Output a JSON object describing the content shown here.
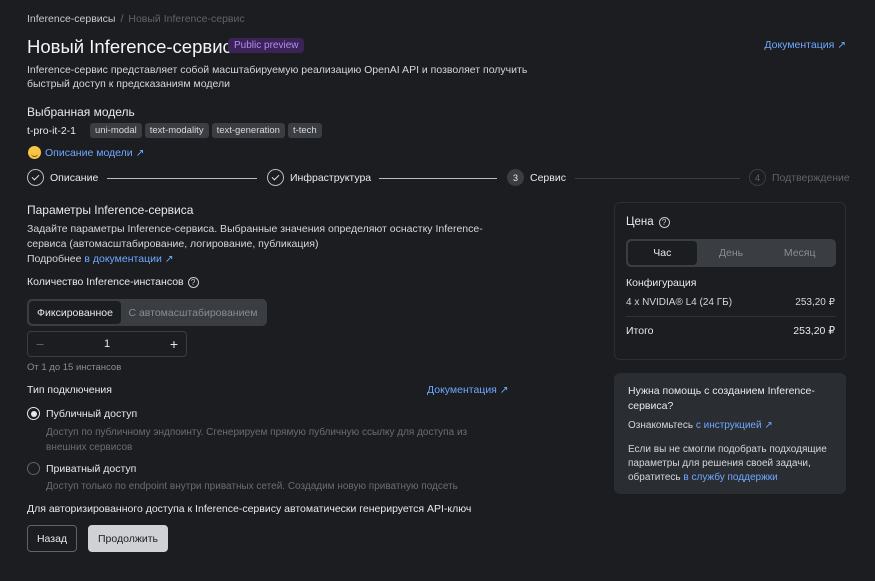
{
  "breadcrumb": {
    "parent": "Inference-сервисы",
    "separator": "/",
    "current": "Новый Inference-сервис"
  },
  "header": {
    "title": "Новый Inference-сервис",
    "badge": "Public preview",
    "doc_link": "Документация ↗",
    "description": "Inference-сервис представляет собой масштабируемую реализацию OpenAI API и позволяет получить быстрый доступ к предсказаниям модели"
  },
  "model": {
    "heading": "Выбранная модель",
    "name": "t-pro-it-2-1",
    "tags": [
      "uni-modal",
      "text-modality",
      "text-generation",
      "t-tech"
    ],
    "description_link": "Описание модели ↗"
  },
  "stepper": {
    "steps": [
      {
        "label": "Описание",
        "number": ""
      },
      {
        "label": "Инфраструктура",
        "number": ""
      },
      {
        "label": "Сервис",
        "number": "3"
      },
      {
        "label": "Подтверждение",
        "number": "4"
      }
    ]
  },
  "params": {
    "heading": "Параметры Inference-сервиса",
    "description": "Задайте параметры Inference-сервиса. Выбранные значения определяют оснастку Inference-сервиса (автомасштабирование, логирование, публикация)",
    "more_prefix": "Подробнее ",
    "more_link": "в документации ↗"
  },
  "instances": {
    "heading": "Количество Inference-инстансов",
    "help_icon": "?",
    "modes": [
      "Фиксированное",
      "С автомасштабированием"
    ],
    "selected_mode": "Фиксированное",
    "minus": "−",
    "value": "1",
    "plus": "+",
    "range_hint": "От 1 до 15 инстансов"
  },
  "connection": {
    "heading": "Тип подключения",
    "doc_link": "Документация ↗",
    "public_label": "Публичный доступ",
    "public_help": "Доступ по публичному эндпоинту. Сгенерируем прямую публичную ссылку для доступа из внешних сервисов",
    "private_label": "Приватный доступ",
    "private_help": "Доступ только по endpoint внутри приватных сетей. Создадим новую приватную подсеть",
    "selected": "public"
  },
  "api_note": "Для авторизированного доступа к Inference-сервису автоматически генерируется API-ключ",
  "actions": {
    "back": "Назад",
    "next": "Продолжить"
  },
  "price": {
    "title": "Цена",
    "help_icon": "?",
    "periods": [
      "Час",
      "День",
      "Месяц"
    ],
    "selected_period": "Час",
    "config_label": "Конфигурация",
    "config_item": "4 x NVIDIA® L4 (24 ГБ)",
    "config_price": "253,20 ₽",
    "total_label": "Итого",
    "total_price": "253,20 ₽"
  },
  "help_card": {
    "title": "Нужна помощь с созданием Inference-сервиса?",
    "text1_prefix": "Ознакомьтесь ",
    "text1_link": "с инструкцией ↗",
    "text2_prefix": "Если вы не смогли подобрать подходящие параметры для решения своей задачи, обратитесь ",
    "text2_link": "в службу поддержки"
  },
  "colors": {
    "background": "#1b1d21",
    "accent_link": "#6fa8ff",
    "badge_bg": "#3a2457",
    "badge_text": "#b48cf0"
  }
}
